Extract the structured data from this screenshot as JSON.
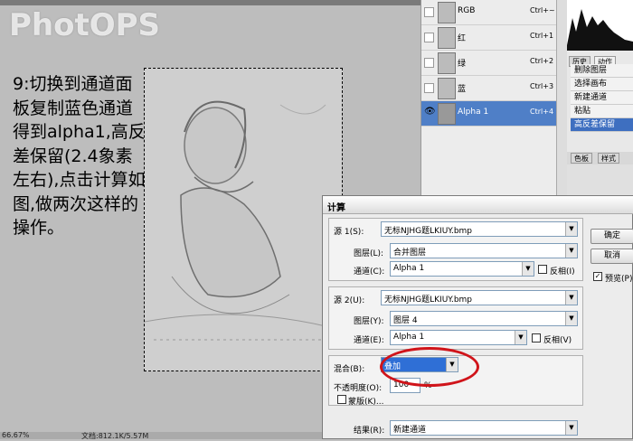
{
  "watermark": "PhotOPS",
  "instruction": "9:切换到通道面板复制蓝色通道得到alpha1,高反差保留(2.4象素左右),点击计算如图,做两次这样的操作。",
  "status": {
    "zoom": "66.67%",
    "doc": "文档:812.1K/5.57M"
  },
  "channels": [
    {
      "name": "RGB",
      "key": "Ctrl+~"
    },
    {
      "name": "红",
      "key": "Ctrl+1"
    },
    {
      "name": "绿",
      "key": "Ctrl+2"
    },
    {
      "name": "蓝",
      "key": "Ctrl+3"
    },
    {
      "name": "Alpha 1",
      "key": "Ctrl+4"
    }
  ],
  "history": {
    "tabs": [
      "历史",
      "动作"
    ],
    "items": [
      "删除图层",
      "选择画布",
      "新建通道",
      "粘贴",
      "高反差保留"
    ]
  },
  "swatch_tabs": [
    "色板",
    "样式"
  ],
  "dialog": {
    "title": "计算",
    "source1": {
      "label": "源 1(S):",
      "file": "无标NJHG题LKIUY.bmp",
      "layer_label": "图层(L):",
      "layer": "合并图层",
      "channel_label": "通道(C):",
      "channel": "Alpha 1",
      "invert": "反相(I)"
    },
    "source2": {
      "label": "源 2(U):",
      "file": "无标NJHG题LKIUY.bmp",
      "layer_label": "图层(Y):",
      "layer": "图层 4",
      "channel_label": "通道(E):",
      "channel": "Alpha 1",
      "invert": "反相(V)"
    },
    "blend_label": "混合(B):",
    "blend": "叠加",
    "opacity_label": "不透明度(O):",
    "opacity": "100",
    "percent": "%",
    "mask": "蒙版(K)...",
    "result_label": "结果(R):",
    "result": "新建通道",
    "ok": "确定",
    "cancel": "取消",
    "preview": "预览(P)"
  }
}
